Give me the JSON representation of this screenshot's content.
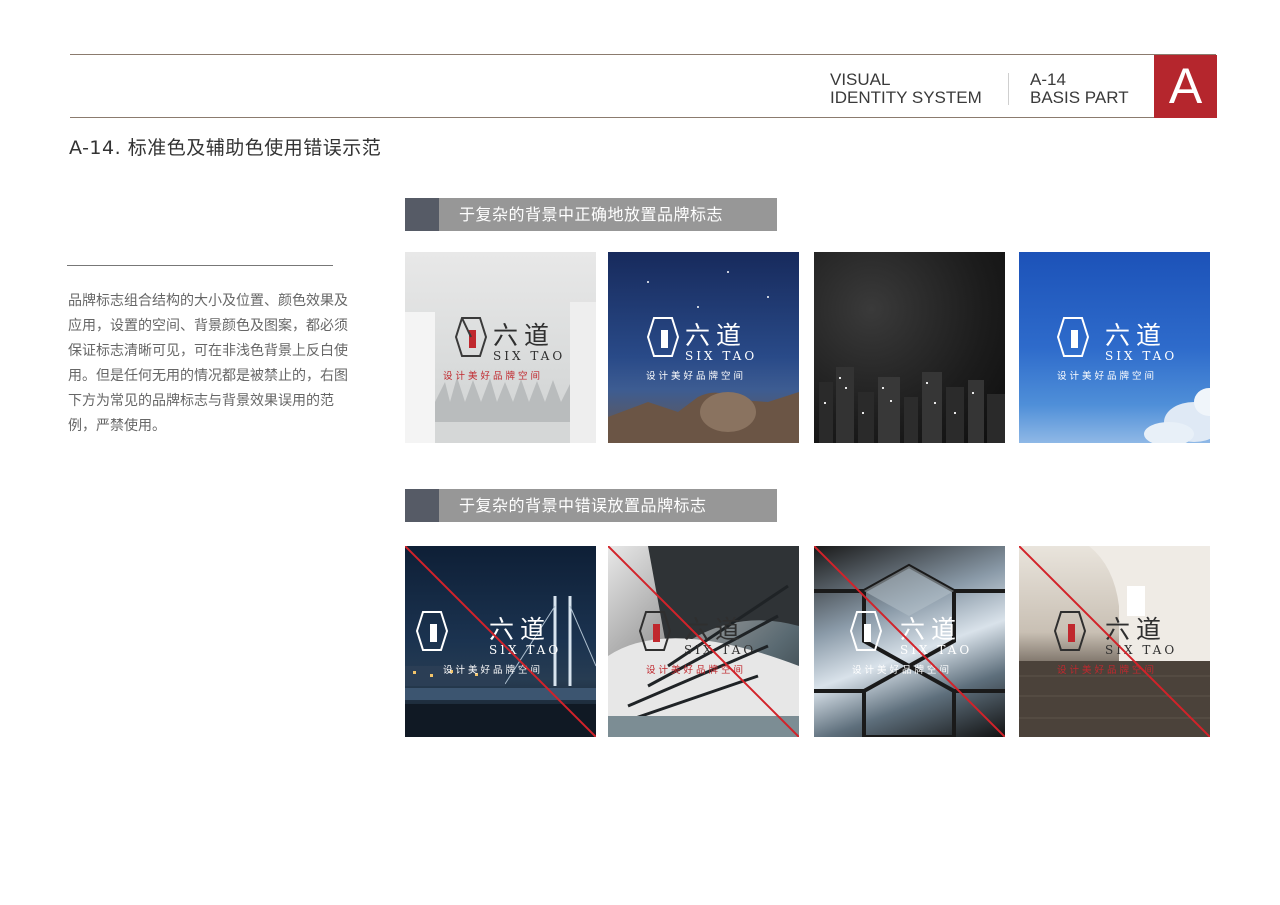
{
  "header": {
    "system_line1": "VISUAL",
    "system_line2": "IDENTITY SYSTEM",
    "part_line1": "A-14",
    "part_line2": "BASIS PART",
    "badge": "A",
    "accent_color": "#b5262d"
  },
  "page_title": "A-14. 标准色及辅助色使用错误示范",
  "description": "品牌标志组合结构的大小及位置、颜色效果及应用，设置的空间、背景颜色及图案，都必须保证标志清晰可见，可在非浅色背景上反白使用。但是任何无用的情况都是被禁止的，右图下方为常见的品牌标志与背景效果误用的范例，严禁使用。",
  "sections": [
    {
      "label": "于复杂的背景中正确地放置品牌标志"
    },
    {
      "label": "于复杂的背景中错误放置品牌标志"
    }
  ],
  "logo": {
    "name_zh": "六道",
    "name_en": "SIX TAO",
    "tagline": "设计美好品牌空间"
  },
  "tiles_correct": [
    {
      "background": "foggy-forest-photo",
      "logo_tone": "dark"
    },
    {
      "background": "night-sky-architecture-photo",
      "logo_tone": "light"
    },
    {
      "background": "dark-city-skyline-photo",
      "logo_tone": "none"
    },
    {
      "background": "blue-sky-clouds-photo",
      "logo_tone": "light"
    }
  ],
  "tiles_wrong": [
    {
      "background": "night-bridge-city-photo",
      "logo_tone": "light"
    },
    {
      "background": "abstract-structure-photo",
      "logo_tone": "dark"
    },
    {
      "background": "mirror-hexagon-photo",
      "logo_tone": "light"
    },
    {
      "background": "stone-interior-photo",
      "logo_tone": "dark"
    }
  ]
}
